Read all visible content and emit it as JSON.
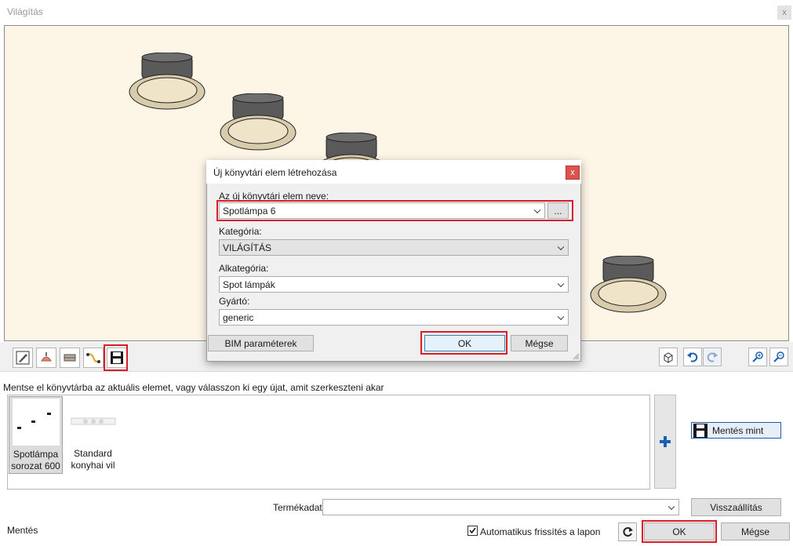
{
  "window": {
    "title": "Világítás",
    "close_glyph": "x"
  },
  "toolbar": {
    "left_icons": [
      "edit-pencil-icon",
      "lamp-icon",
      "material-icon",
      "curve-icon",
      "save-disk-icon"
    ],
    "right_icons": [
      "3d-box-icon",
      "undo-icon",
      "redo-icon",
      "zoom-in-icon",
      "zoom-out-icon"
    ]
  },
  "hint": "Mentse el könyvtárba az aktuális elemet, vagy válasszon ki egy újat, amit szerkeszteni akar",
  "library": {
    "items": [
      {
        "line1": "Spotlámpa",
        "line2": "sorozat 600",
        "selected": true
      },
      {
        "line1": "Standard",
        "line2": "konyhai vil",
        "selected": false
      }
    ],
    "add_icon": "plus-icon",
    "save_as_label": "Mentés mint"
  },
  "bottom": {
    "product_label": "Termékadat",
    "product_value": "",
    "reset_label": "Visszaállítás",
    "status_text": "Mentés",
    "auto_refresh_label": "Automatikus frissítés a lapon",
    "auto_refresh_checked": true,
    "refresh_icon": "refresh-icon",
    "ok_label": "OK",
    "cancel_label": "Mégse"
  },
  "dialog": {
    "title": "Új könyvtári elem létrehozása",
    "close_glyph": "x",
    "name_label": "Az új könyvtári elem neve:",
    "name_value": "Spotlámpa 6",
    "browse_label": "...",
    "category_label": "Kategória:",
    "category_value": "VILÁGÍTÁS",
    "subcategory_label": "Alkategória:",
    "subcategory_value": "Spot lámpák",
    "manufacturer_label": "Gyártó:",
    "manufacturer_value": "generic",
    "bim_label": "BIM paraméterek",
    "ok_label": "OK",
    "cancel_label": "Mégse"
  },
  "colors": {
    "highlight": "#d91e2a",
    "viewport_bg": "#fdf5e6",
    "accent": "#1b5fb0"
  }
}
